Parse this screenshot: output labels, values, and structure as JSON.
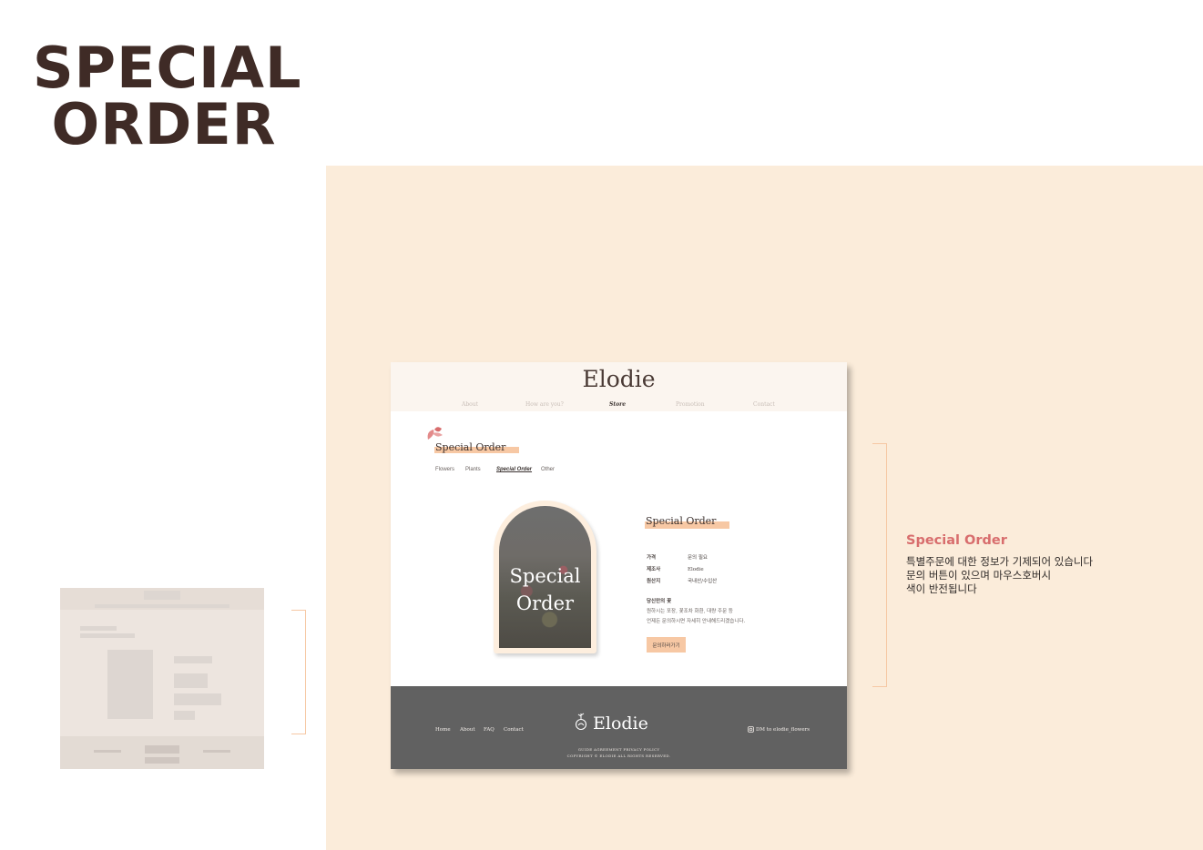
{
  "page_title": [
    "SPECIAL",
    "ORDER"
  ],
  "mockup": {
    "logo": "Elodie",
    "nav": [
      "About",
      "How are you?",
      "Store",
      "Promotion",
      "Contact"
    ],
    "active_nav": "Store",
    "section_title": "Special Order",
    "tabs": [
      "Flowers",
      "Plants",
      "Special Order",
      "Other"
    ],
    "active_tab": "Special Order",
    "product_image_text": [
      "Special",
      "Order"
    ],
    "product_title": "Special Order",
    "info": [
      {
        "key": "가격",
        "value": "문의 필요"
      },
      {
        "key": "제조사",
        "value": "Elodie"
      },
      {
        "key": "원산지",
        "value": "국내산/수입산"
      }
    ],
    "description_title": "당신만의 꽃",
    "description_lines": [
      "원하시는 포장, 꽃조차 화환, 대량 주문 등",
      "언제든 문의하시면 자세히 안내해드리겠습니다."
    ],
    "button_label": "문의하러가기",
    "footer": {
      "links": [
        "Home",
        "About",
        "FAQ",
        "Contact"
      ],
      "logo": "Elodie",
      "instagram": "DM to elodie_flowers",
      "legal_1": "GUIDE AGREEMENT PRIVACY POLICY",
      "legal_2": "COPYRIGHT © ELODIE ALL RIGHTS RESERVED."
    }
  },
  "annotation": {
    "title": "Special Order",
    "lines": [
      "특별주문에 대한 정보가 기제되어 있습니다",
      "문의 버튼이 있으며 마우스호버시",
      "색이 반전됩니다"
    ]
  },
  "colors": {
    "title_brown": "#3f2b26",
    "panel_beige": "#fbecda",
    "accent_peach": "#f7c8a4",
    "annotation_pink": "#d86d6d",
    "footer_gray": "#616161"
  }
}
